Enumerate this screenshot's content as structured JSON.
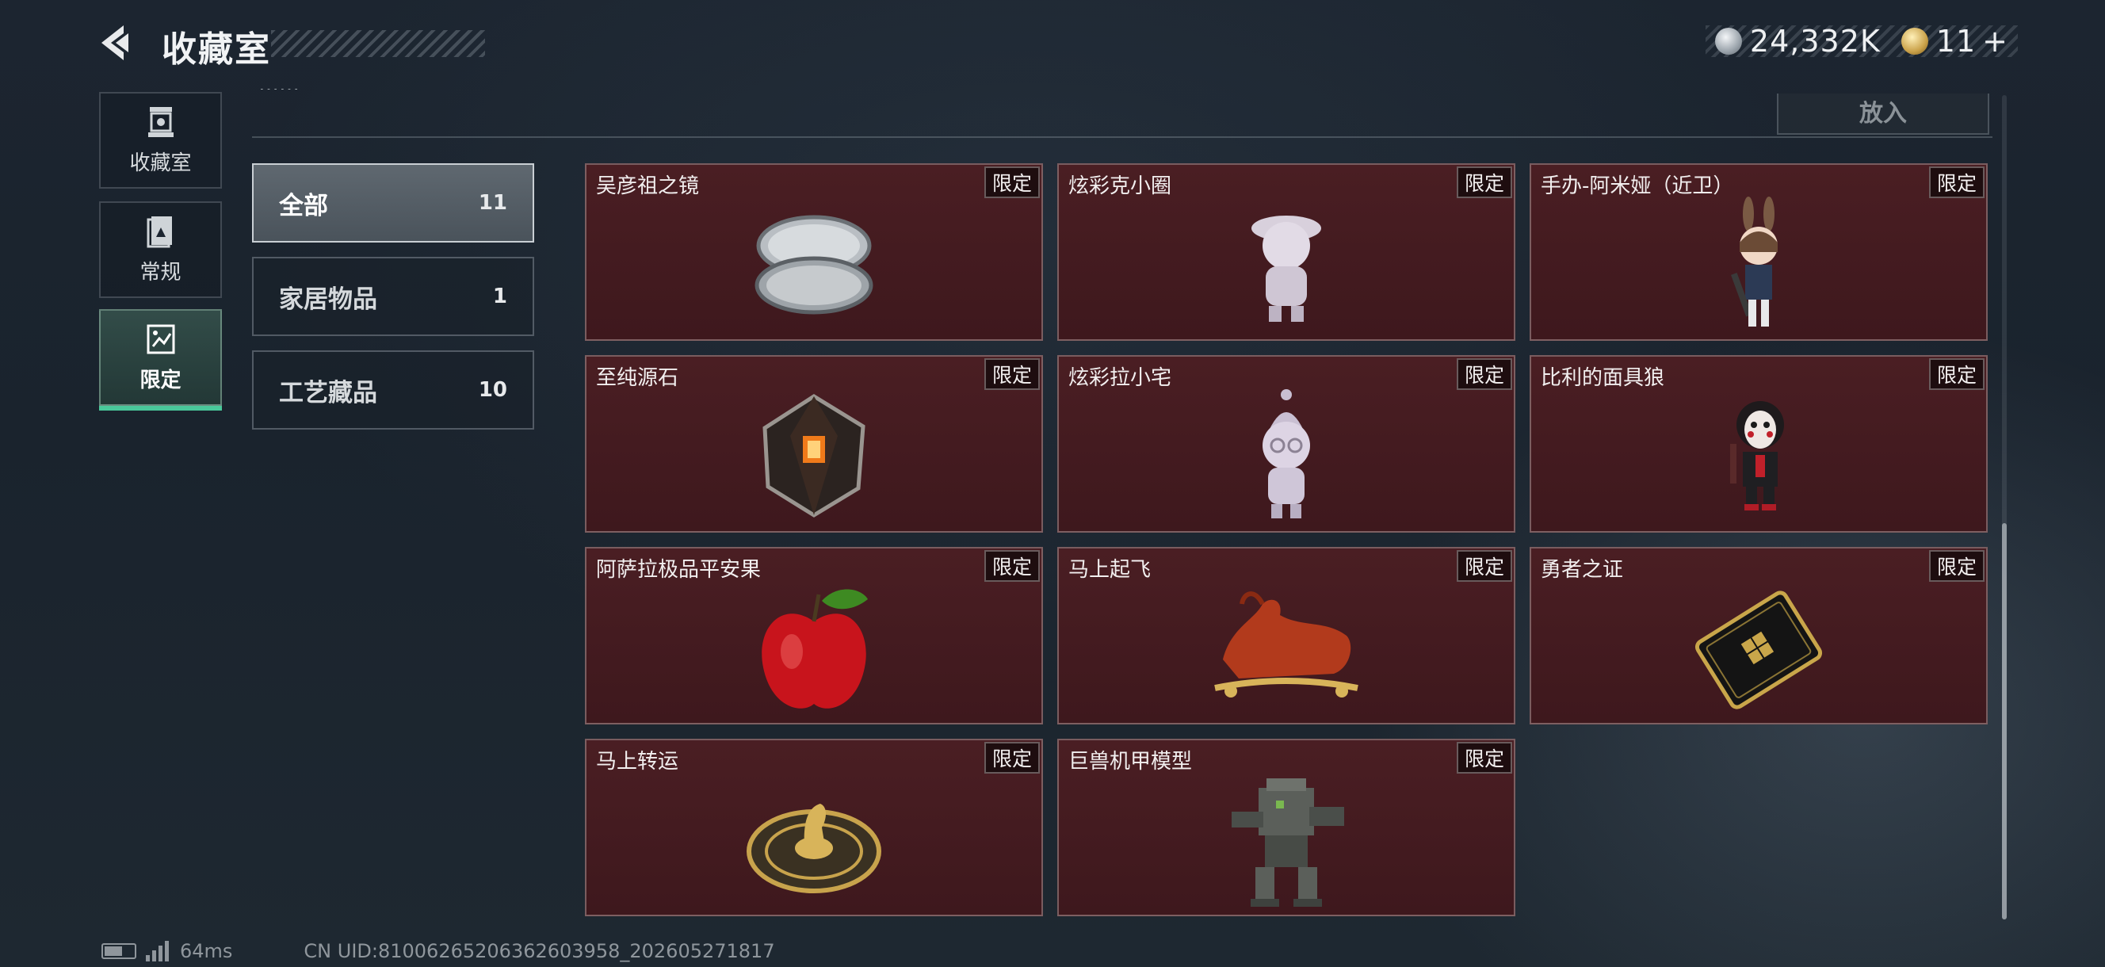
{
  "header": {
    "title": "收藏室",
    "silver_amount": "24,332K",
    "gold_amount": "11",
    "gold_plus": "+"
  },
  "side_tabs": [
    {
      "label": "收藏室",
      "icon": "trophy-icon"
    },
    {
      "label": "常规",
      "icon": "album-icon"
    },
    {
      "label": "限定",
      "icon": "limited-collection-icon",
      "active": true
    }
  ],
  "top_bar": {
    "put_label": "放入",
    "cut_text": "……"
  },
  "categories": [
    {
      "name": "全部",
      "count": "11",
      "active": true
    },
    {
      "name": "家居物品",
      "count": "1"
    },
    {
      "name": "工艺藏品",
      "count": "10"
    }
  ],
  "items": [
    {
      "name": "吴彦祖之镜",
      "badge": "限定",
      "icon": "compact-mirror-icon"
    },
    {
      "name": "炫彩克小圈",
      "badge": "限定",
      "icon": "figurine-icon"
    },
    {
      "name": "手办-阿米娅（近卫）",
      "badge": "限定",
      "icon": "bunny-figure-icon"
    },
    {
      "name": "至纯源石",
      "badge": "限定",
      "icon": "crystal-icon"
    },
    {
      "name": "炫彩拉小宅",
      "badge": "限定",
      "icon": "figurine-icon"
    },
    {
      "name": "比利的面具狼",
      "badge": "限定",
      "icon": "mask-doll-icon"
    },
    {
      "name": "阿萨拉极品平安果",
      "badge": "限定",
      "icon": "apple-icon"
    },
    {
      "name": "马上起飞",
      "badge": "限定",
      "icon": "horse-icon"
    },
    {
      "name": "勇者之证",
      "badge": "限定",
      "icon": "card-icon"
    },
    {
      "name": "马上转运",
      "badge": "限定",
      "icon": "coin-horse-icon"
    },
    {
      "name": "巨兽机甲模型",
      "badge": "限定",
      "icon": "mech-icon"
    }
  ],
  "footer": {
    "ping": "64ms",
    "uid": "CN UID:8100626520636260395​8_202605271817"
  },
  "colors": {
    "card_bg": "#4a1e23",
    "active_accent": "#49c89a"
  }
}
